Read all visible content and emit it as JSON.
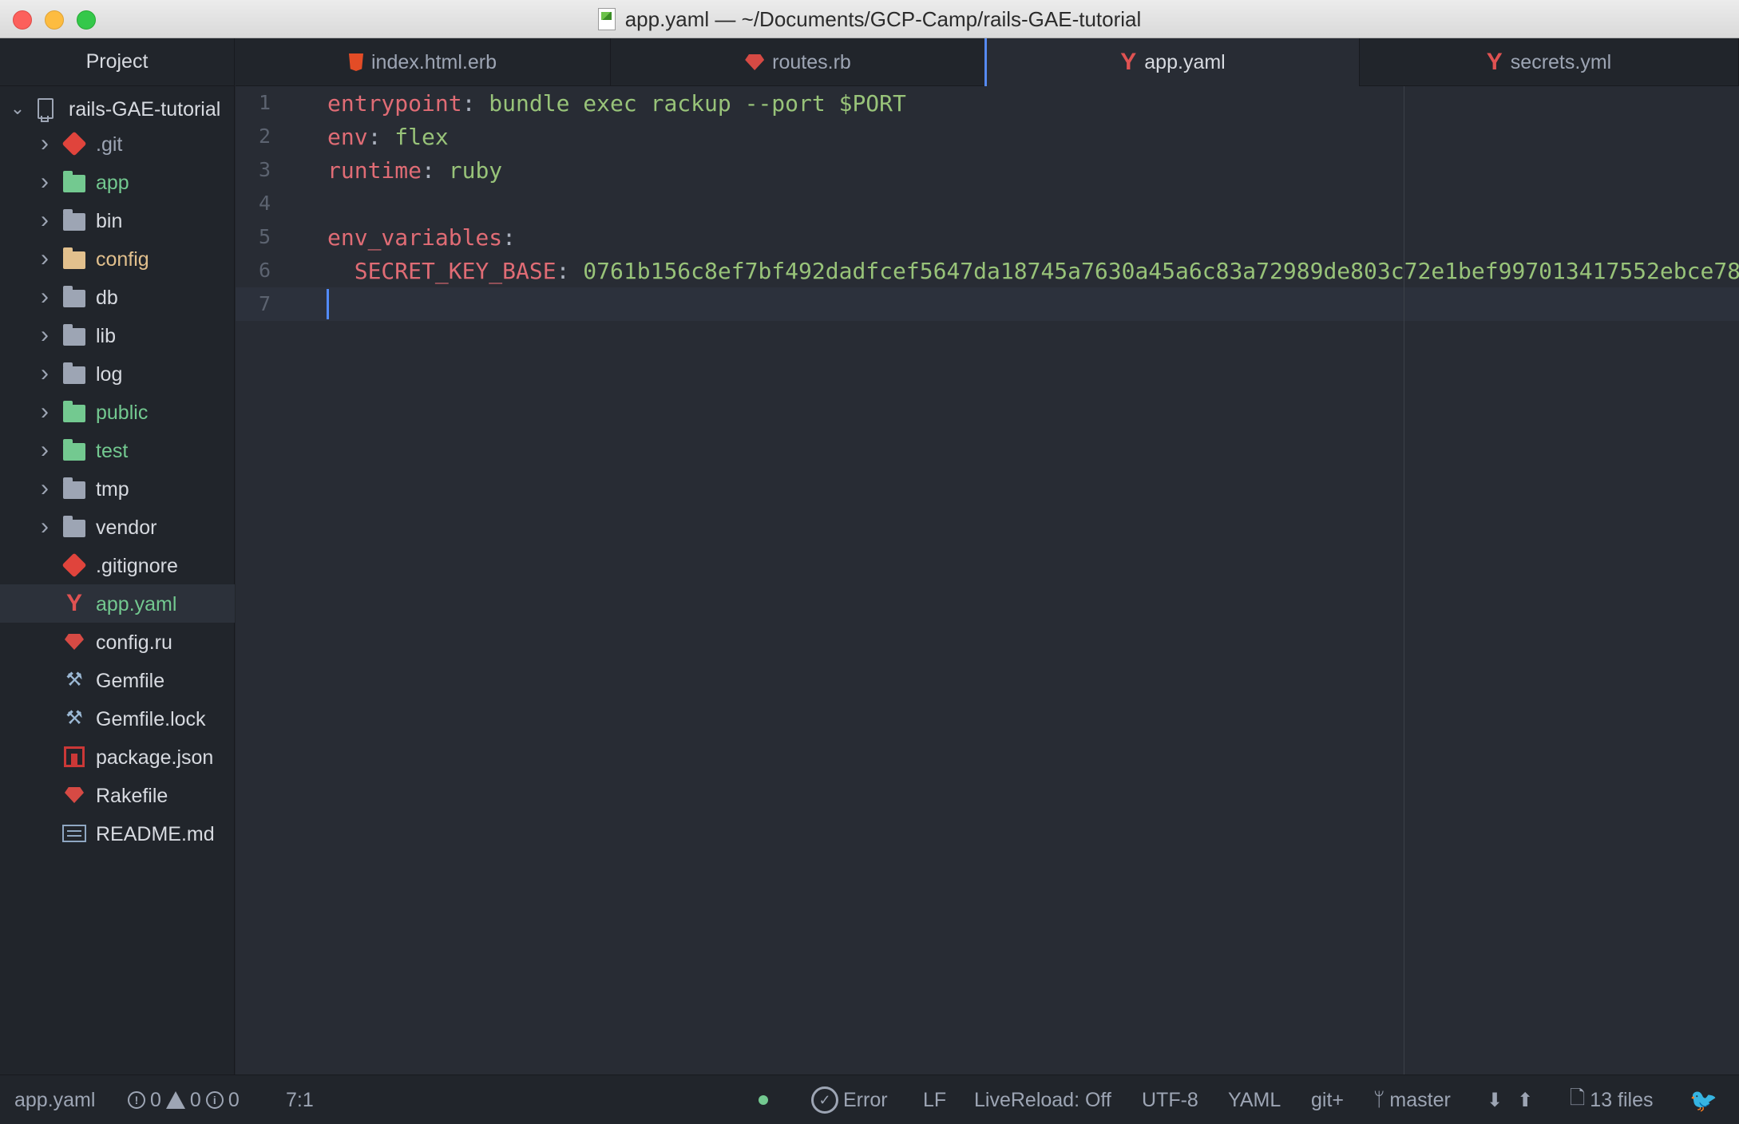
{
  "window": {
    "title": "app.yaml — ~/Documents/GCP-Camp/rails-GAE-tutorial"
  },
  "sidebar": {
    "header": "Project",
    "root": "rails-GAE-tutorial",
    "items": [
      {
        "label": ".git",
        "kind": "folder",
        "icon": "git-icon",
        "color": "#9da5b4"
      },
      {
        "label": "app",
        "kind": "folder",
        "icon": "folder-icon",
        "color": "#73c990"
      },
      {
        "label": "bin",
        "kind": "folder",
        "icon": "folder-icon",
        "color": "#d7dae0"
      },
      {
        "label": "config",
        "kind": "folder",
        "icon": "folder-icon",
        "color": "#e2c08d"
      },
      {
        "label": "db",
        "kind": "folder",
        "icon": "folder-icon",
        "color": "#d7dae0"
      },
      {
        "label": "lib",
        "kind": "folder",
        "icon": "folder-icon",
        "color": "#d7dae0"
      },
      {
        "label": "log",
        "kind": "folder",
        "icon": "folder-icon",
        "color": "#d7dae0"
      },
      {
        "label": "public",
        "kind": "folder",
        "icon": "folder-icon",
        "color": "#73c990"
      },
      {
        "label": "test",
        "kind": "folder",
        "icon": "folder-icon",
        "color": "#73c990"
      },
      {
        "label": "tmp",
        "kind": "folder",
        "icon": "folder-icon",
        "color": "#d7dae0"
      },
      {
        "label": "vendor",
        "kind": "folder",
        "icon": "folder-icon",
        "color": "#d7dae0"
      },
      {
        "label": ".gitignore",
        "kind": "file",
        "icon": "git-icon",
        "color": "#d7dae0"
      },
      {
        "label": "app.yaml",
        "kind": "file",
        "icon": "yaml-icon",
        "color": "#73c990"
      },
      {
        "label": "config.ru",
        "kind": "file",
        "icon": "ruby-icon",
        "color": "#d7dae0"
      },
      {
        "label": "Gemfile",
        "kind": "file",
        "icon": "bundler-icon",
        "color": "#d7dae0"
      },
      {
        "label": "Gemfile.lock",
        "kind": "file",
        "icon": "bundler-icon",
        "color": "#d7dae0"
      },
      {
        "label": "package.json",
        "kind": "file",
        "icon": "npm-icon",
        "color": "#d7dae0"
      },
      {
        "label": "Rakefile",
        "kind": "file",
        "icon": "ruby-icon",
        "color": "#d7dae0"
      },
      {
        "label": "README.md",
        "kind": "file",
        "icon": "markdown-icon",
        "color": "#d7dae0"
      }
    ]
  },
  "tabs": [
    {
      "label": "index.html.erb",
      "icon": "html-icon"
    },
    {
      "label": "routes.rb",
      "icon": "ruby-icon"
    },
    {
      "label": "app.yaml",
      "icon": "yaml-icon",
      "active": true
    },
    {
      "label": "secrets.yml",
      "icon": "yaml-icon"
    }
  ],
  "editor": {
    "line_numbers": [
      "1",
      "2",
      "3",
      "4",
      "5",
      "6",
      "7"
    ],
    "lines": [
      {
        "key": "entrypoint",
        "sep": ":",
        "value": " bundle exec rackup --port $PORT"
      },
      {
        "key": "env",
        "sep": ":",
        "value": " flex"
      },
      {
        "key": "runtime",
        "sep": ":",
        "value": " ruby"
      },
      {
        "key": "",
        "sep": "",
        "value": ""
      },
      {
        "key": "env_variables",
        "sep": ":",
        "value": ""
      },
      {
        "key": "  SECRET_KEY_BASE",
        "sep": ":",
        "value": " 0761b156c8ef7bf492dadfcef5647da18745a7630a45a6c83a72989de803c72e1bef997013417552ebce78"
      },
      {
        "key": "",
        "sep": "",
        "value": ""
      }
    ],
    "cursor_line": 7
  },
  "statusbar": {
    "file": "app.yaml",
    "errors": "0",
    "warnings": "0",
    "infos": "0",
    "cursor_pos": "7:1",
    "lint_status": "Error",
    "line_ending": "LF",
    "livereload": "LiveReload: Off",
    "encoding": "UTF-8",
    "grammar": "YAML",
    "git_status": "git+",
    "branch": "master",
    "file_count": "13 files"
  }
}
